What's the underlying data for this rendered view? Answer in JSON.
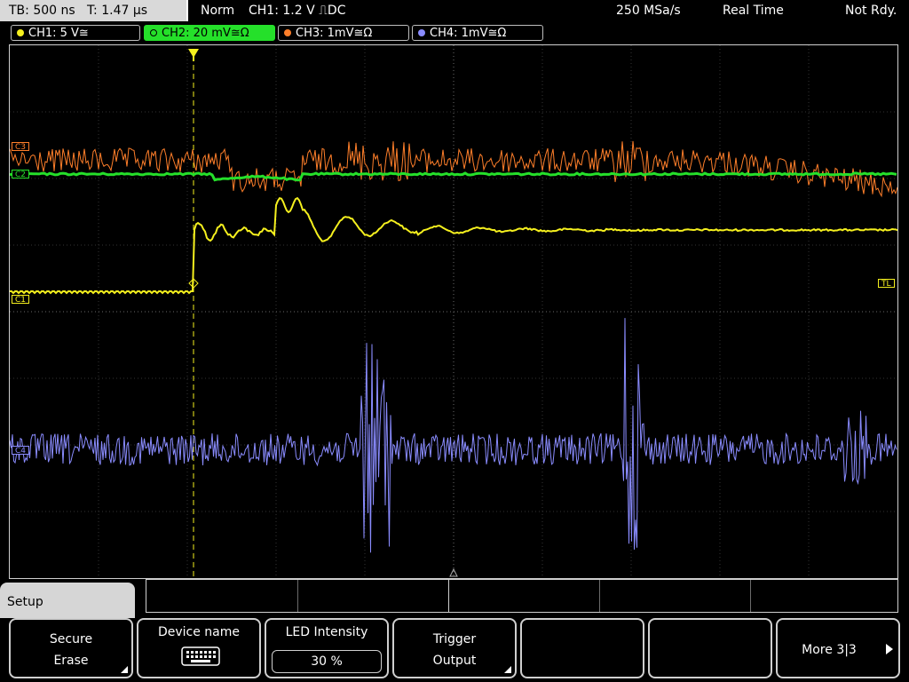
{
  "topbar": {
    "timebase": "TB: 500 ns",
    "trigger_time": "T: 1.47 µs",
    "mode": "Norm",
    "trigger_source": "CH1: 1.2 V ⎍DC",
    "sample_rate": "250 MSa/s",
    "acq_mode": "Real Time",
    "status": "Not Rdy."
  },
  "channels": [
    {
      "label": "CH1: 5 V≅",
      "color": "#f5f01e"
    },
    {
      "label": "CH2: 20 mV≅Ω",
      "color": "#25e02a"
    },
    {
      "label": "CH3: 1mV≅Ω",
      "color": "#ff7f2a"
    },
    {
      "label": "CH4: 1mV≅Ω",
      "color": "#8a8cff"
    }
  ],
  "markers": {
    "c3": "C3",
    "c2": "C2",
    "c1": "C1",
    "c4": "C4",
    "tl": "TL"
  },
  "menu": {
    "title": "Setup",
    "keys": [
      {
        "line1": "Secure",
        "line2": "Erase"
      },
      {
        "line1": "Device name",
        "icon": "keyboard-icon"
      },
      {
        "line1": "LED Intensity",
        "value": "30 %"
      },
      {
        "line1": "Trigger",
        "line2": "Output"
      },
      {
        "line1": ""
      },
      {
        "line1": ""
      },
      {
        "line1": "More 3|3"
      }
    ]
  }
}
